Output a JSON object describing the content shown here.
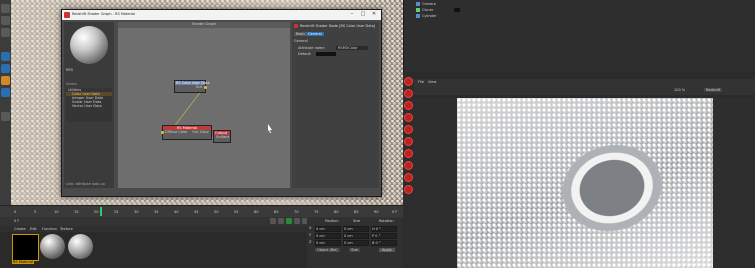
{
  "shader_window": {
    "title": "Redshift Shader Graph - RS Material",
    "minimize": "–",
    "maximize": "□",
    "close": "✕",
    "graph_header": "Shader Graph",
    "preview_label": "RRS",
    "node_list_header": "Nodes",
    "node_list": [
      "Utilities",
      "Color User Data",
      "Integer User Data",
      "Scalar User Data",
      "Vector User Data"
    ],
    "status": "Link: attribute look-up",
    "nodes": {
      "user_data": {
        "title": "RS Color User Data",
        "port": "Out"
      },
      "material": {
        "title": "RS Material",
        "ports": [
          "Diffuse Color",
          "Out Color"
        ]
      },
      "output": {
        "title": "Output",
        "port": "Surface"
      }
    },
    "attributes": {
      "title": "Redshift Shader Node [RS Color User Data]",
      "tabs": [
        "Basic",
        "General"
      ],
      "section": "General",
      "attr_label": "Attribute name",
      "attr_value": "RSMOColor",
      "default_label": "Default"
    }
  },
  "timeline": {
    "ticks": [
      "0",
      "5",
      "10",
      "15",
      "20",
      "25",
      "30",
      "35",
      "40",
      "45",
      "50",
      "55",
      "60",
      "65",
      "70",
      "75",
      "80",
      "85",
      "90"
    ],
    "frame": "0 F"
  },
  "materials": {
    "tabs": [
      "Create",
      "Edit",
      "Function",
      "Texture"
    ],
    "items": [
      "RS Material",
      "",
      ""
    ]
  },
  "coords": {
    "headers": [
      "Position",
      "Size",
      "Rotation"
    ],
    "rows": [
      {
        "axis": "X",
        "pos": "0 cm",
        "size": "0 cm",
        "rot": "H 0 °"
      },
      {
        "axis": "Y",
        "pos": "0 cm",
        "size": "0 cm",
        "rot": "P 0 °"
      },
      {
        "axis": "Z",
        "pos": "0 cm",
        "size": "0 cm",
        "rot": "B 0 °"
      }
    ],
    "mode": "Object (Rel)",
    "size_mode": "Size",
    "apply": "Apply"
  },
  "object_manager": {
    "tabs": [
      "File",
      "Edit",
      "View",
      "Objects",
      "Tags",
      "Bookmarks"
    ],
    "items": [
      "Camera",
      "Cloner",
      "Cylinder"
    ]
  },
  "render_view": {
    "menu": [
      "File",
      "View"
    ],
    "zoom": "100 %",
    "renderer": "Redshift"
  },
  "colors": {
    "accent": "#e0c040",
    "node_red": "#c03a3a",
    "tool_red": "#b22222"
  }
}
